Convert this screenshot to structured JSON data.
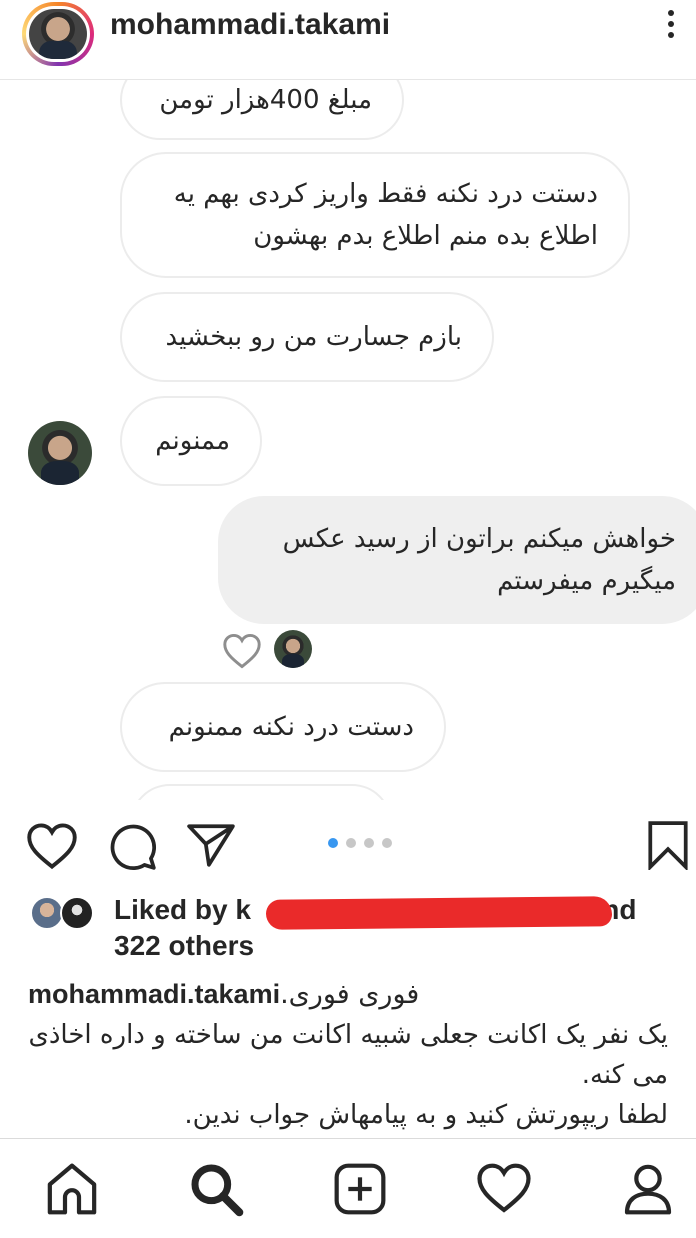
{
  "header": {
    "username": "mohammadi.takami"
  },
  "chat": {
    "messages": [
      {
        "text": "مبلغ 400هزار تومن",
        "side": "received"
      },
      {
        "text": "دستت درد نکنه فقط واریز کردی بهم یه اطلاع بده منم اطلاع بدم بهشون",
        "side": "received"
      },
      {
        "text": "بازم جسارت من رو ببخشید",
        "side": "received"
      },
      {
        "text": "ممنونم",
        "side": "received"
      },
      {
        "text": "خواهش میکنم براتون از رسید عکس میگیرم میفرستم",
        "side": "sent"
      },
      {
        "text": "دستت درد نکنه ممنونم",
        "side": "received"
      }
    ]
  },
  "actions": {
    "like_icon": "heart-outline-icon",
    "comment_icon": "comment-icon",
    "share_icon": "paper-plane-icon",
    "save_icon": "bookmark-icon",
    "carousel": {
      "count": 4,
      "active_index": 0,
      "active_color": "#3897f0",
      "inactive_color": "#c7c7c7"
    }
  },
  "likes": {
    "prefix": "Liked by ",
    "user_partial": "k",
    "suffix": " and",
    "others": "322 others",
    "redaction_color": "#ea2a2a"
  },
  "caption": {
    "username": "mohammadi.takami",
    "first_line": " فوری فوری.",
    "line2": "یک نفر یک اکانت جعلی شبیه اکانت من ساخته و داره اخاذی می کنه.",
    "line3": "لطفا ریپورتش کنید و به پیامهاش جواب ندین."
  },
  "bottom_nav": {
    "items": [
      "home-icon",
      "search-icon",
      "new-post-icon",
      "activity-heart-icon",
      "profile-icon"
    ],
    "active": "search-icon"
  }
}
